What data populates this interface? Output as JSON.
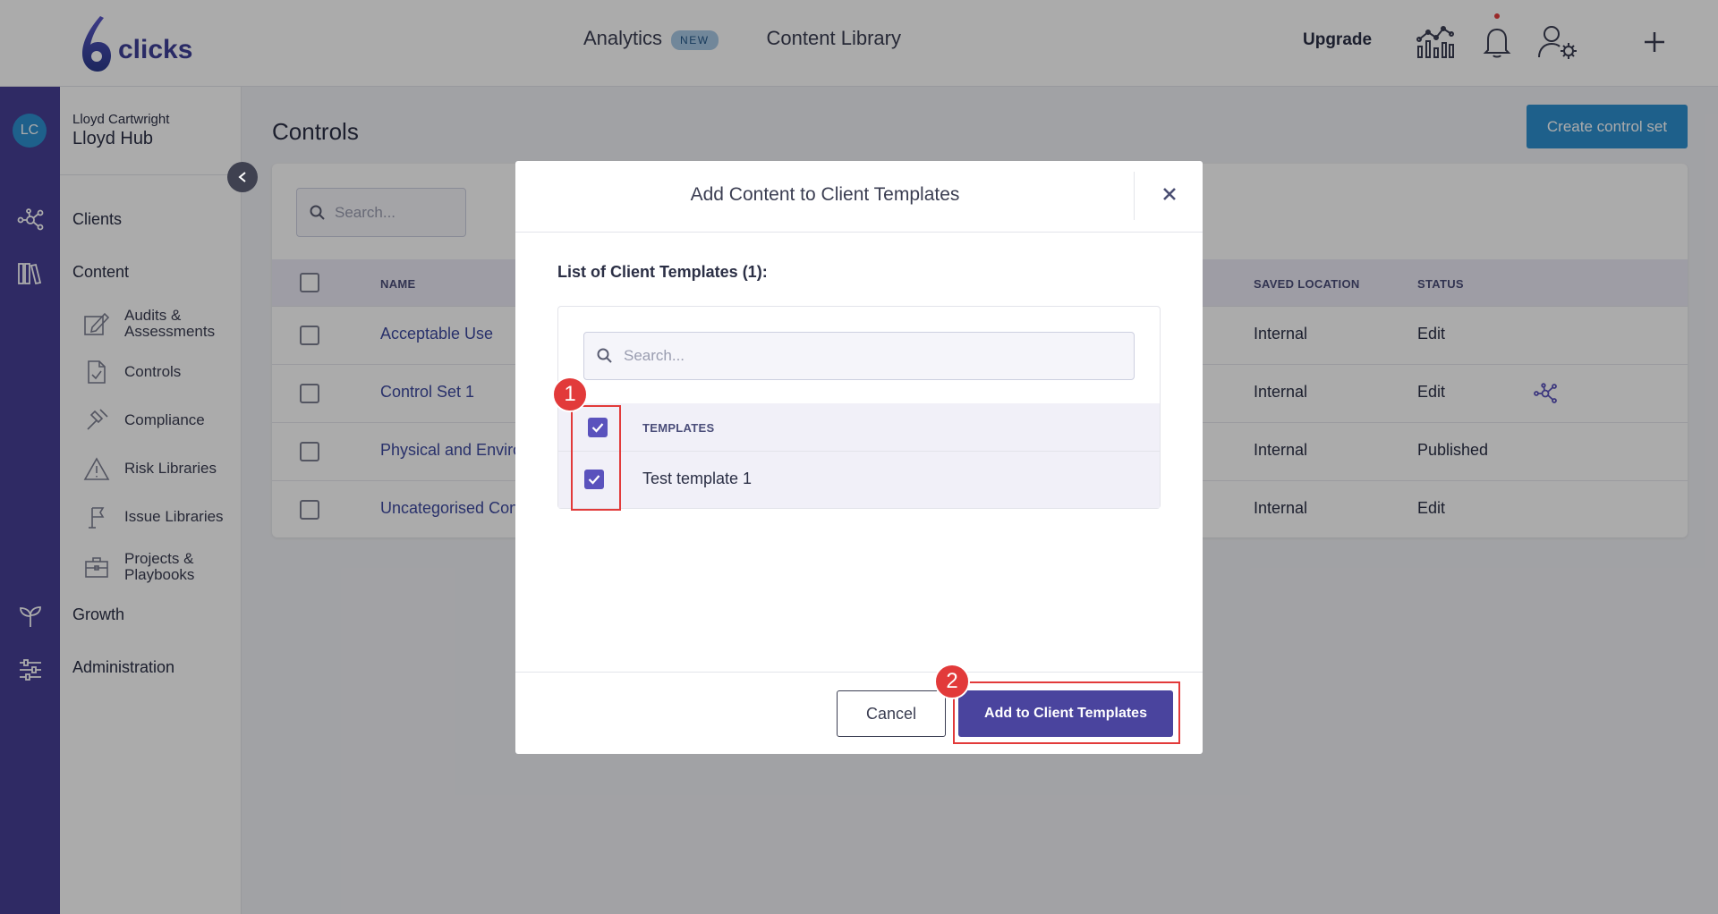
{
  "brand": {
    "name": "clicks"
  },
  "topnav": {
    "analytics": "Analytics",
    "analytics_badge": "NEW",
    "content_library": "Content Library",
    "upgrade": "Upgrade"
  },
  "rail": {
    "avatar_initials": "LC"
  },
  "sidebar": {
    "user_name": "Lloyd Cartwright",
    "hub_name": "Lloyd Hub",
    "clients": "Clients",
    "content": "Content",
    "items": [
      {
        "label": "Audits & Assessments",
        "icon": "edit-icon"
      },
      {
        "label": "Controls",
        "icon": "document-check-icon"
      },
      {
        "label": "Compliance",
        "icon": "gavel-icon"
      },
      {
        "label": "Risk Libraries",
        "icon": "warning-icon"
      },
      {
        "label": "Issue Libraries",
        "icon": "flag-icon"
      },
      {
        "label": "Projects & Playbooks",
        "icon": "briefcase-icon"
      }
    ],
    "growth": "Growth",
    "administration": "Administration"
  },
  "main": {
    "title": "Controls",
    "create_button": "Create control set",
    "search_placeholder": "Search...",
    "columns": {
      "name": "NAME",
      "saved_location": "SAVED LOCATION",
      "status": "STATUS"
    },
    "rows": [
      {
        "name": "Acceptable Use",
        "location": "Internal",
        "status": "Edit"
      },
      {
        "name": "Control Set 1",
        "location": "Internal",
        "status": "Edit"
      },
      {
        "name": "Physical and Enviro",
        "location": "Internal",
        "status": "Published"
      },
      {
        "name": "Uncategorised Cont",
        "location": "Internal",
        "status": "Edit"
      }
    ]
  },
  "modal": {
    "title": "Add Content to Client Templates",
    "list_label": "List of Client Templates (1):",
    "search_placeholder": "Search...",
    "column_header": "TEMPLATES",
    "templates": [
      {
        "name": "Test template 1",
        "checked": true
      }
    ],
    "cancel": "Cancel",
    "submit": "Add to Client Templates"
  },
  "annotations": {
    "step1": "1",
    "step2": "2",
    "highlight_color": "#e23a3a"
  },
  "colors": {
    "primary": "#463f96",
    "accent": "#2d8fd0",
    "link": "#3e4aa0"
  }
}
